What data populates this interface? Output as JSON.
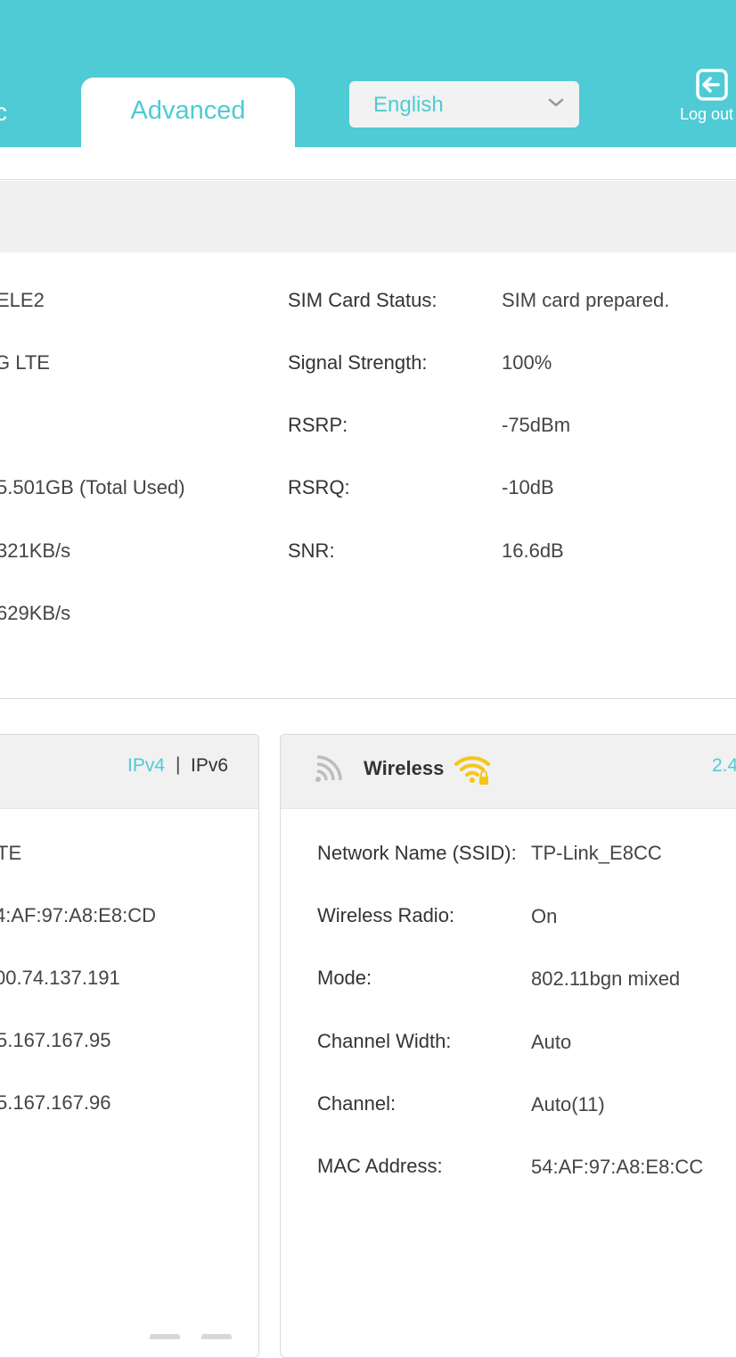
{
  "header": {
    "basic_tab_partial": "c",
    "advanced_tab": "Advanced",
    "language": "English",
    "logout": "Log out"
  },
  "status": {
    "left_values": [
      "ELE2",
      "G LTE",
      "5.501GB (Total Used)",
      "321KB/s",
      "629KB/s"
    ],
    "right": [
      {
        "label": "SIM Card Status:",
        "value": "SIM card prepared."
      },
      {
        "label": "Signal Strength:",
        "value": "100%"
      },
      {
        "label": "RSRP:",
        "value": "-75dBm"
      },
      {
        "label": "RSRQ:",
        "value": "-10dB"
      },
      {
        "label": "SNR:",
        "value": "16.6dB"
      }
    ]
  },
  "internet": {
    "ipv4": "IPv4",
    "separator": "|",
    "ipv6": "IPv6",
    "values": [
      "TE",
      "4:AF:97:A8:E8:CD",
      "00.74.137.191",
      "5.167.167.95",
      "5.167.167.96"
    ]
  },
  "wireless": {
    "title": "Wireless",
    "band_partial": "2.4",
    "rows": [
      {
        "label": "Network Name (SSID):",
        "value": "TP-Link_E8CC"
      },
      {
        "label": "Wireless Radio:",
        "value": "On"
      },
      {
        "label": "Mode:",
        "value": "802.11bgn mixed"
      },
      {
        "label": "Channel Width:",
        "value": "Auto"
      },
      {
        "label": "Channel:",
        "value": "Auto(11)"
      },
      {
        "label": "MAC Address:",
        "value": "54:AF:97:A8:E8:CC"
      }
    ]
  },
  "icons": {
    "logout": "logout-icon",
    "chevron": "chevron-down-icon",
    "signal": "signal-icon",
    "wifi": "wifi-lock-icon"
  },
  "colors": {
    "accent": "#4ecbd4",
    "wifi": "#f5c518"
  }
}
